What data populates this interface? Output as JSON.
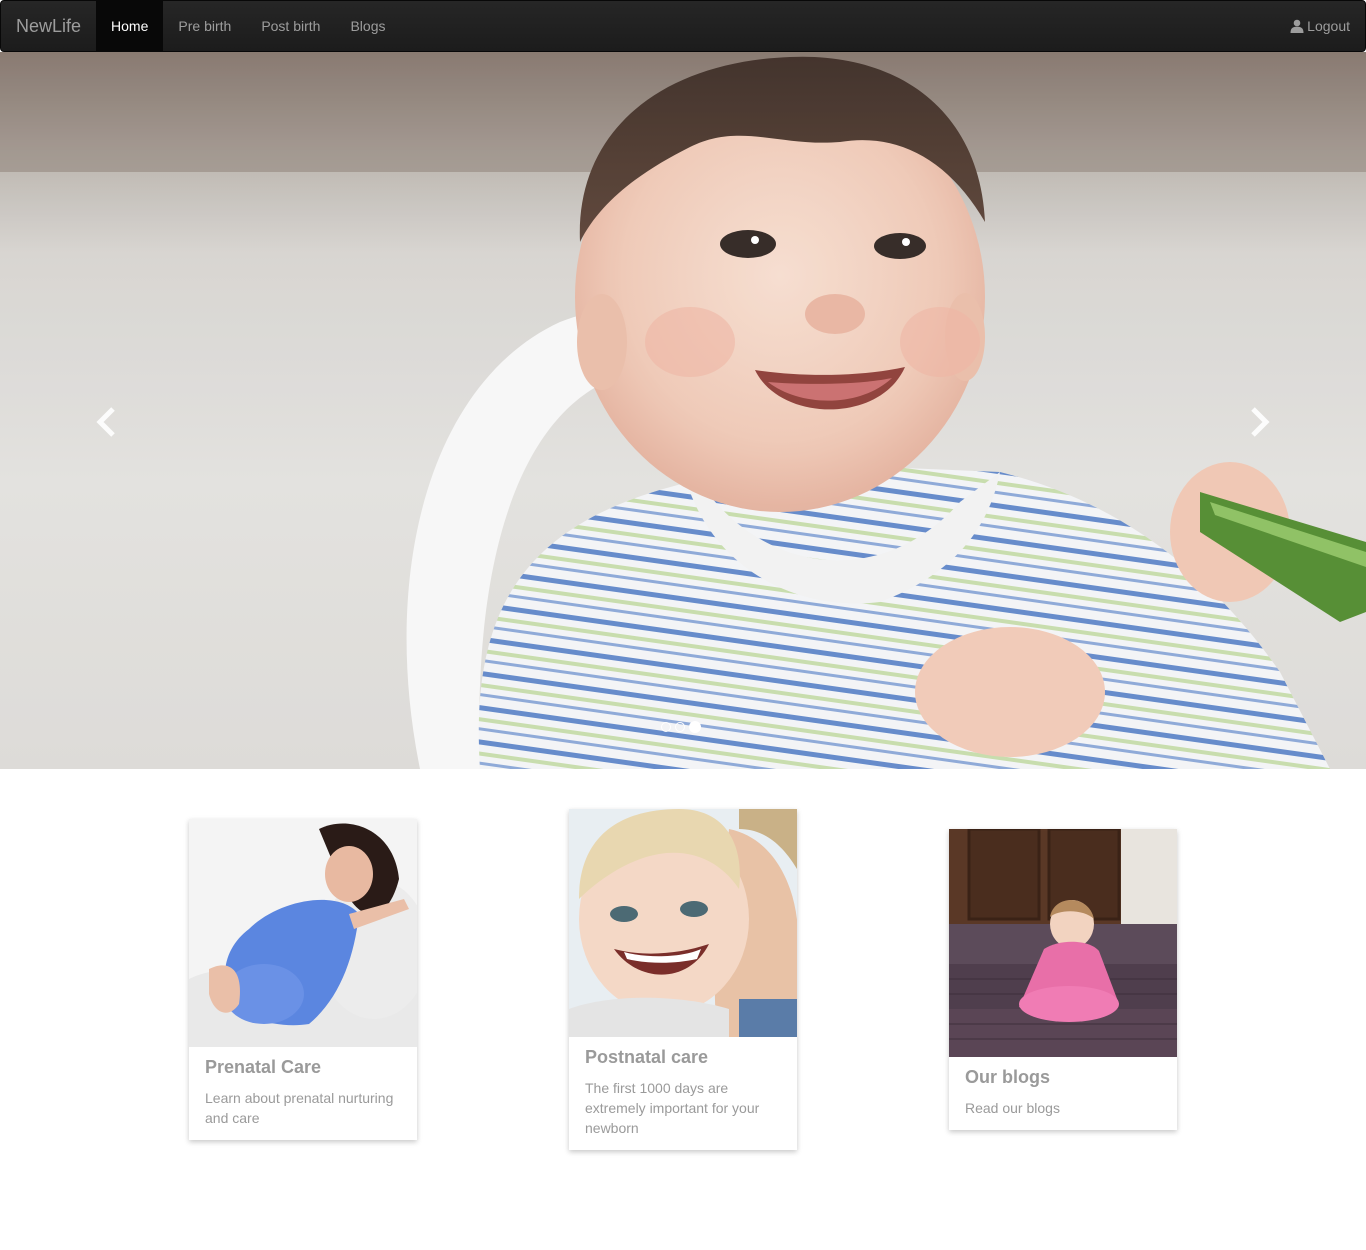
{
  "navbar": {
    "brand": "NewLife",
    "items": [
      {
        "label": "Home",
        "active": true
      },
      {
        "label": "Pre birth",
        "active": false
      },
      {
        "label": "Post birth",
        "active": false
      },
      {
        "label": "Blogs",
        "active": false
      }
    ],
    "logout_label": "Logout"
  },
  "carousel": {
    "slide_count": 3,
    "active_slide": 3
  },
  "cards": [
    {
      "title": "Prenatal Care",
      "text": "Learn about prenatal nurturing and care"
    },
    {
      "title": "Postnatal care",
      "text": "The first 1000 days are extremely important for your newborn"
    },
    {
      "title": "Our blogs",
      "text": "Read our blogs"
    }
  ],
  "colors": {
    "navbar_bg": "#222222",
    "nav_text": "#9d9d9d",
    "nav_active_bg": "#080808",
    "card_text": "#9a9a9a"
  }
}
